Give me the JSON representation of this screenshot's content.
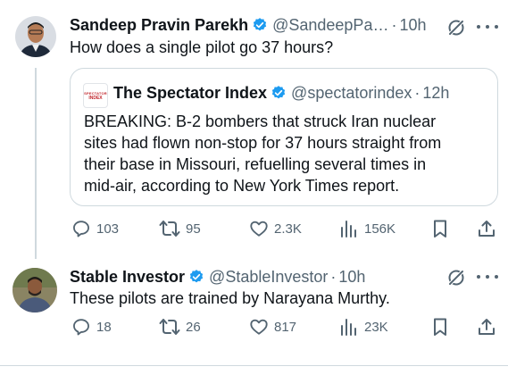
{
  "tweets": [
    {
      "author": "Sandeep Pravin Parekh",
      "handle": "@SandeepPa…",
      "time": "10h",
      "text": "How does a single pilot go 37 hours?",
      "actions": {
        "reply": "103",
        "repost": "95",
        "like": "2.3K",
        "views": "156K"
      }
    },
    {
      "author": "Stable Investor",
      "handle": "@StableInvestor",
      "time": "10h",
      "text": "These pilots are trained by Narayana Murthy.",
      "actions": {
        "reply": "18",
        "repost": "26",
        "like": "817",
        "views": "23K"
      }
    }
  ],
  "quote": {
    "author": "The Spectator Index",
    "handle": "@spectatorindex",
    "time": "12h",
    "avatar_text_top": "SPECTATOR",
    "avatar_text_bottom": "INDEX",
    "lines": [
      "BREAKING: B-2 bombers that struck Iran nuclear",
      "sites had flown non-stop for 37 hours straight from",
      "their base in Missouri, refuelling several times in",
      "mid-air, according to New York Times report."
    ]
  },
  "colors": {
    "verified": "#1d9bf0",
    "muted": "#536471",
    "text": "#0f1419",
    "border": "#cfd9de"
  },
  "icons": [
    "grok-icon",
    "more-icon",
    "reply-icon",
    "repost-icon",
    "like-icon",
    "views-icon",
    "bookmark-icon",
    "share-icon",
    "verified-badge-icon"
  ]
}
